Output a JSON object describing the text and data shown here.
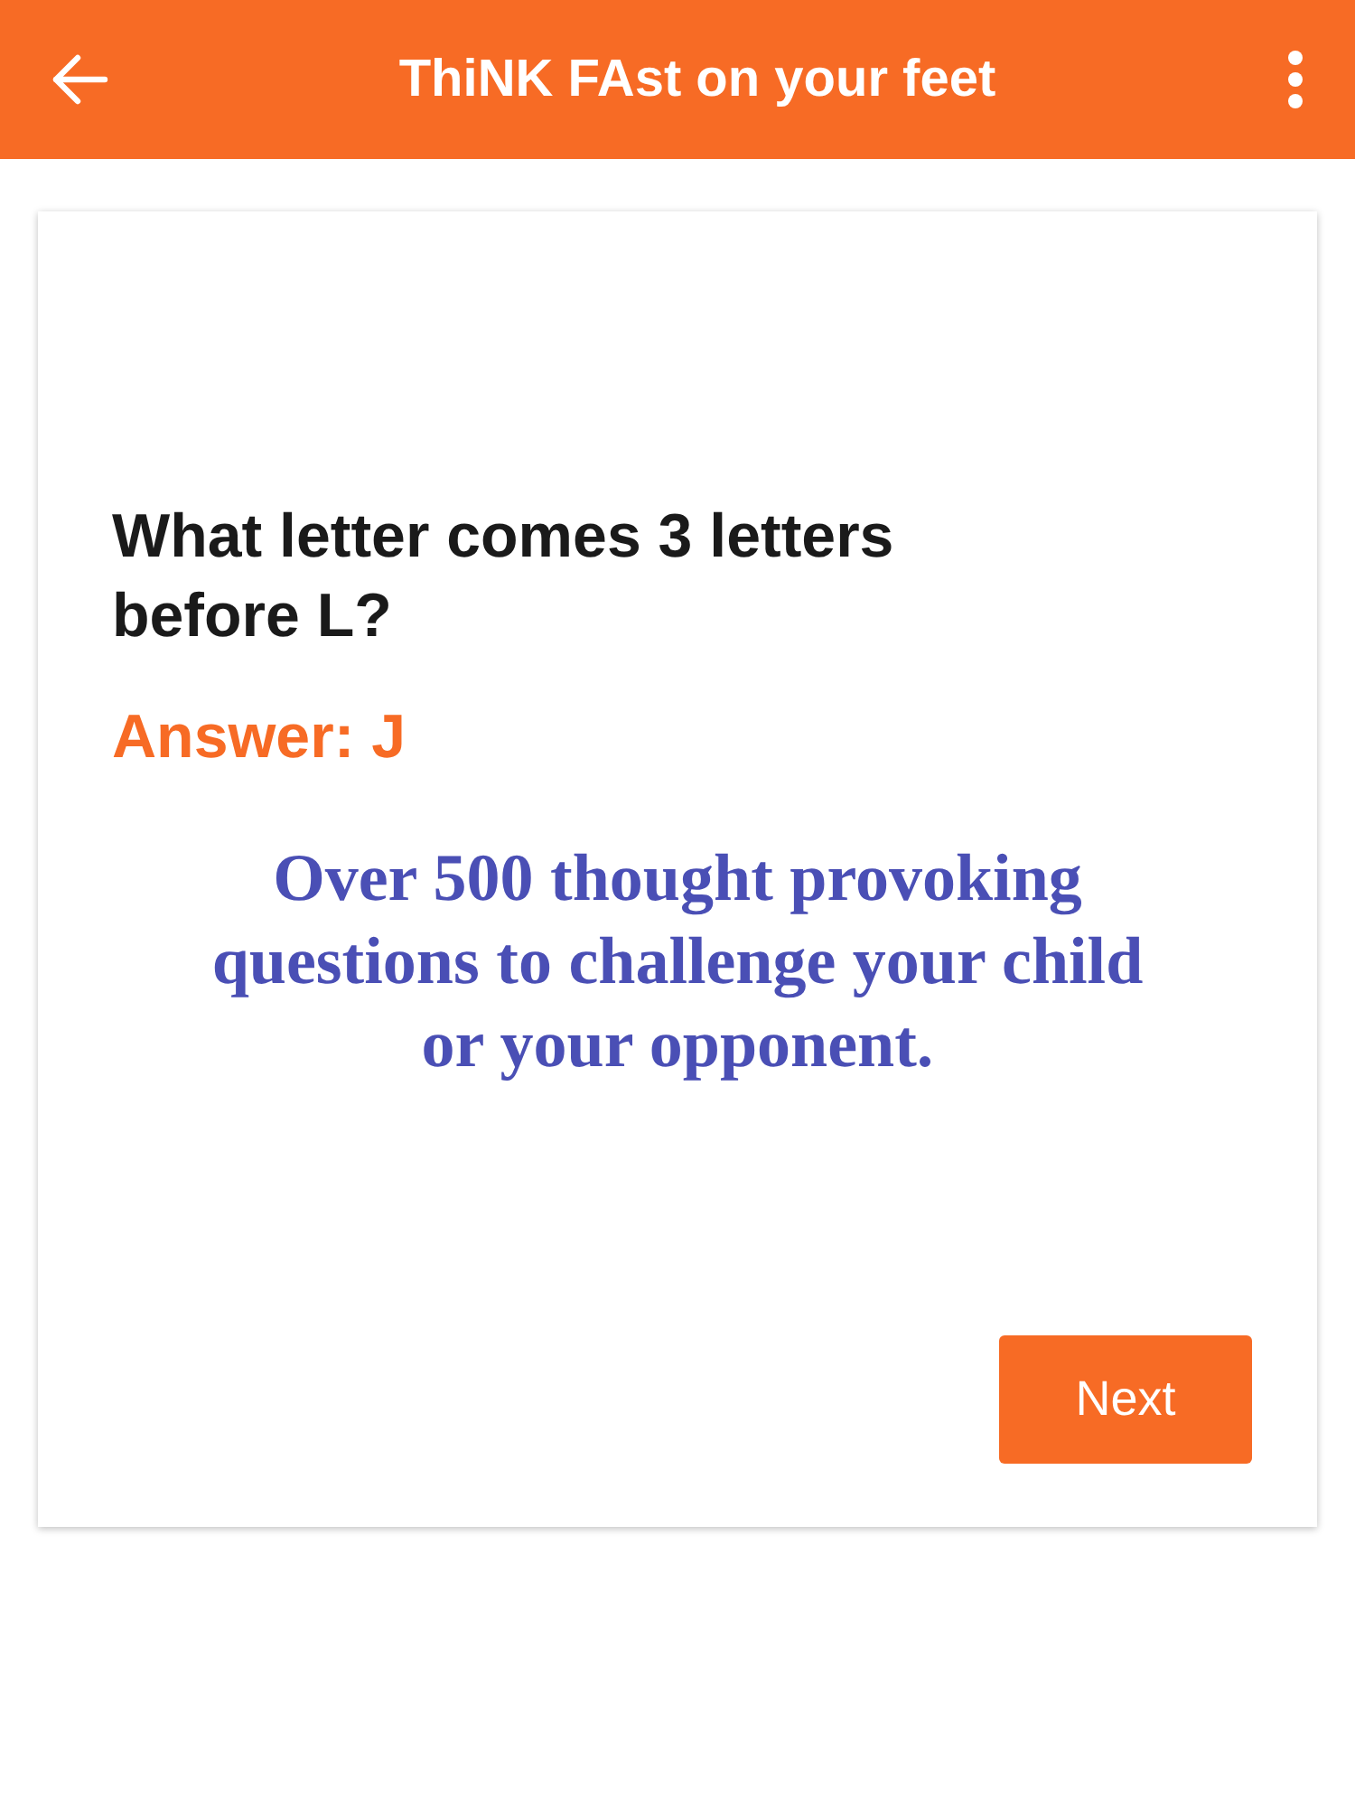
{
  "app_bar": {
    "title": "ThiNK FAst on your feet"
  },
  "card": {
    "question": "What letter comes 3 letters before L?",
    "answer": "Answer: J",
    "promo": "Over 500 thought provoking questions to challenge your child or your opponent.",
    "button": "Next"
  }
}
